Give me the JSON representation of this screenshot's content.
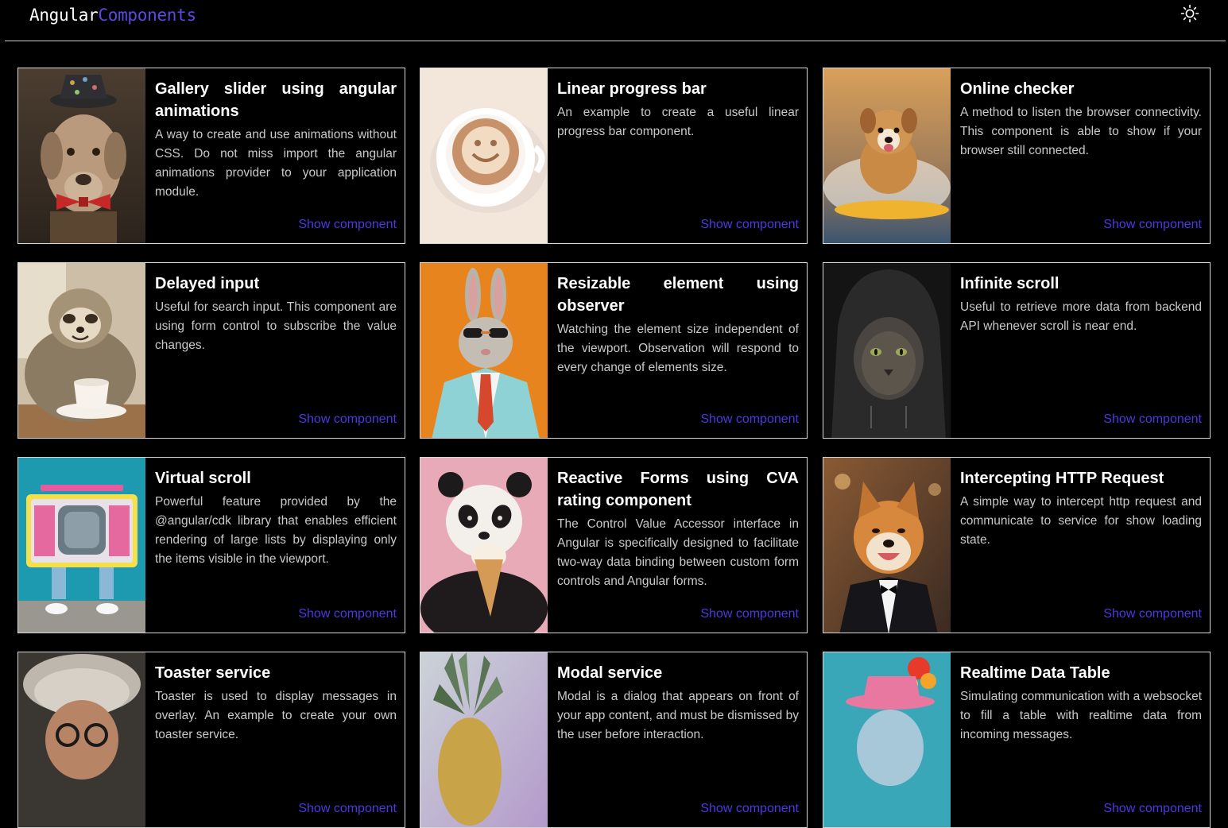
{
  "header": {
    "logo_part1": "Angular",
    "logo_part2": "Components",
    "theme_icon": "sun-icon"
  },
  "cards": [
    {
      "title": "Gallery slider using angular animations",
      "description": "A way to create and use animations without CSS. Do not miss import the angular animations provider to your application module.",
      "link": "Show component",
      "image": "dog-with-party-hat"
    },
    {
      "title": "Linear progress bar",
      "description": "An example to create a useful linear progress bar component.",
      "link": "Show component",
      "image": "smiley-coffee-cup"
    },
    {
      "title": "Online checker",
      "description": "A method to listen the browser connectivity. This component is able to show if your browser still connected.",
      "link": "Show component",
      "image": "surfing-dog"
    },
    {
      "title": "Delayed input",
      "description": "Useful for search input. This component are using form control to subscribe the value changes.",
      "link": "Show component",
      "image": "sloth-with-coffee"
    },
    {
      "title": "Resizable element using observer",
      "description": "Watching the element size independent of the viewport. Observation will respond to every change of elements size.",
      "link": "Show component",
      "image": "rabbit-in-suit"
    },
    {
      "title": "Infinite scroll",
      "description": "Useful to retrieve more data from backend API whenever scroll is near end.",
      "link": "Show component",
      "image": "cat-in-hoodie"
    },
    {
      "title": "Virtual scroll",
      "description": "Powerful feature provided by the @angular/cdk library that enables efficient rendering of large lists by displaying only the items visible in the viewport.",
      "link": "Show component",
      "image": "tv-with-legs"
    },
    {
      "title": "Reactive Forms using CVA rating component",
      "description": "The Control Value Accessor interface in Angular is specifically designed to facilitate two-way data binding between custom form controls and Angular forms.",
      "link": "Show component",
      "image": "panda-ice-cream"
    },
    {
      "title": "Intercepting HTTP Request",
      "description": "A simple way to intercept http request and communicate to service for show loading state.",
      "link": "Show component",
      "image": "shiba-in-tuxedo"
    },
    {
      "title": "Toaster service",
      "description": "Toaster is used to display messages in overlay. An example to create your own toaster service.",
      "link": "Show component",
      "image": "old-man-wild-hair"
    },
    {
      "title": "Modal service",
      "description": "Modal is a dialog that appears on front of your app content, and must be dismissed by the user before interaction.",
      "link": "Show component",
      "image": "pineapple"
    },
    {
      "title": "Realtime Data Table",
      "description": "Simulating communication with a websocket to fill a table with realtime data from incoming messages.",
      "link": "Show component",
      "image": "clown-with-hat"
    }
  ],
  "colors": {
    "background": "#000000",
    "accent": "#4b39e0",
    "logo_accent": "#5a49e3",
    "border": "#d8d8d8"
  }
}
